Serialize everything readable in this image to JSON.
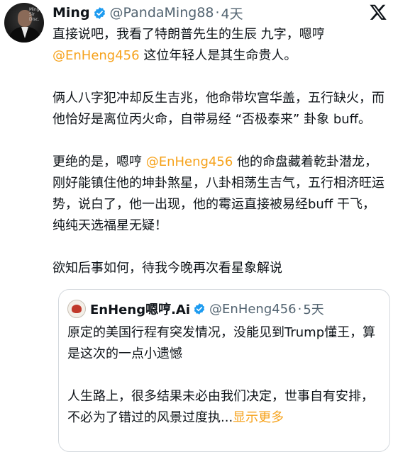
{
  "tweet": {
    "author_name": "Ming",
    "handle": "@PandaMing88",
    "time": "4天",
    "avatar_label": "Ming Sir Disc.",
    "p1_a": "直接说吧，我看了特朗普先生的生辰 九字，嗯哼",
    "p1_mention": "@EnHeng456",
    "p1_b": " 这位年轻人是其生命贵人。",
    "p2": "俩人八字犯冲却反生吉兆，他命带坎宫华盖，五行缺火，而他恰好是离位丙火命，自带易经 “否极泰来” 卦象 buff。",
    "p3_a": "更绝的是，嗯哼 ",
    "p3_mention": "@EnHeng456",
    "p3_b": " 他的命盘藏着乾卦潜龙，刚好能镇住他的坤卦煞星，八卦相荡生吉气，五行相济旺运势，说白了，他一出现，他的霉运直接被易经buff 干飞，纯纯天选福星无疑！",
    "p4": "欲知后事如何，待我今晚再次看星象解说"
  },
  "quoted": {
    "author_name": "EnHeng嗯哼.Ai",
    "handle": "@EnHeng456",
    "time": "5天",
    "p1": "原定的美国行程有突发情况，没能见到Trump懂王，算是这次的一点小遗憾",
    "p2": "人生路上，很多结果未必由我们决定，世事自有安排，不必为了错过的风景过度执...",
    "show_more": "显示更多"
  },
  "colors": {
    "accent": "#f6a21b",
    "verified": "#1d9bf0",
    "muted": "#536471"
  },
  "icons": {
    "verified": "verified-badge-icon",
    "close": "x-logo-icon"
  }
}
